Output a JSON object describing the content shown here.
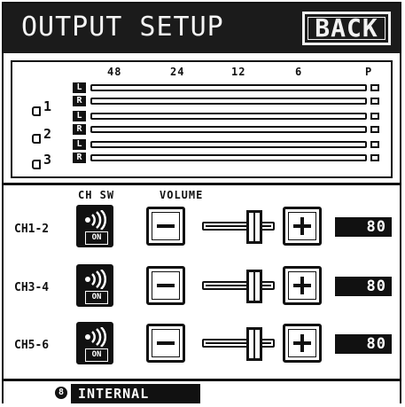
{
  "header": {
    "title": "OUTPUT SETUP",
    "back_label": "BACK"
  },
  "meter": {
    "scale": [
      "48",
      "24",
      "12",
      "6",
      "P"
    ],
    "outputs": [
      {
        "num": "1",
        "left": "L",
        "right": "R"
      },
      {
        "num": "2",
        "left": "L",
        "right": "R"
      },
      {
        "num": "3",
        "left": "L",
        "right": "R"
      }
    ]
  },
  "columns": {
    "ch_sw": "CH SW",
    "volume": "VOLUME"
  },
  "channels": [
    {
      "label": "CH1-2",
      "switch": "ON",
      "minus": "−",
      "plus": "+",
      "volume": "80",
      "level": 0.78
    },
    {
      "label": "CH3-4",
      "switch": "ON",
      "minus": "−",
      "plus": "+",
      "volume": "80",
      "level": 0.78
    },
    {
      "label": "CH5-6",
      "switch": "ON",
      "minus": "−",
      "plus": "+",
      "volume": "80",
      "level": 0.78
    }
  ],
  "footer": {
    "source_num": "8",
    "source_label": "INTERNAL"
  },
  "colors": {
    "background": "#ffffff",
    "foreground": "#111111",
    "header": "#1b1b1b"
  },
  "icons": {
    "speaker": "speaker-sound-icon",
    "output": "output-jack-icon"
  }
}
